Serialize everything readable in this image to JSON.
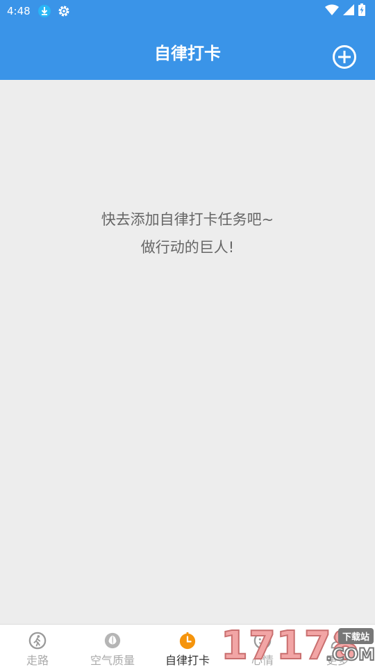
{
  "status_bar": {
    "time": "4:48",
    "icons": [
      "download-icon",
      "settings-icon",
      "wifi-icon",
      "signal-icon",
      "battery-icon"
    ]
  },
  "header": {
    "title": "自律打卡",
    "add_icon": "add-circle-icon"
  },
  "empty_state": {
    "line1": "快去添加自律打卡任务吧~",
    "line2": "做行动的巨人!"
  },
  "bottom_nav": {
    "items": [
      {
        "label": "走路",
        "icon": "walk-icon",
        "active": false
      },
      {
        "label": "空气质量",
        "icon": "leaf-icon",
        "active": false
      },
      {
        "label": "自律打卡",
        "icon": "clock-icon",
        "active": true
      },
      {
        "label": "心情",
        "icon": "mood-icon",
        "active": false
      },
      {
        "label": "更多",
        "icon": "user-icon",
        "active": false
      }
    ]
  },
  "watermark": {
    "digits": "17178",
    "badge": "下载站",
    "suffix": ".COM"
  },
  "colors": {
    "primary": "#3a94e8",
    "background": "#ededed",
    "active_icon": "#f5940c",
    "inactive_icon": "#9a9a9a"
  }
}
